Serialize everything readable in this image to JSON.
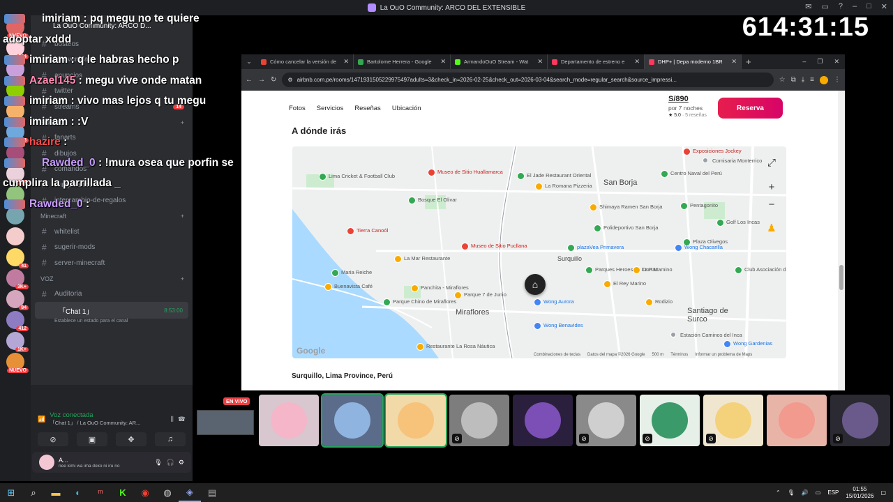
{
  "window": {
    "title": "La OuO Community: ARCO DEL EXTENSIBLE"
  },
  "timer": "614:31:15",
  "chat": [
    {
      "user": "imiriam",
      "text": " : pq megu no te quiere adoptar xddd",
      "color": "white",
      "wrap": true
    },
    {
      "user": "imiriam",
      "text": " : q le habras hecho p",
      "color": "white"
    },
    {
      "user": "Azael145",
      "text": " : megu vive onde matan",
      "color": "pink"
    },
    {
      "user": "imiriam",
      "text": " : vivo mas lejos q tu megu",
      "color": "white"
    },
    {
      "user": "imiriam",
      "text": " : :V",
      "color": "white"
    },
    {
      "user": "hazire",
      "text": " :",
      "color": "red"
    },
    {
      "user": "Rawded_0",
      "text": " : !mura osea que porfin se cumplira la parrillada _",
      "color": "purple",
      "wrap": true
    },
    {
      "user": "Rawded_0",
      "text": " :",
      "color": "purple"
    }
  ],
  "sidebar": {
    "server_name": "La OuO Community: ARCO D...",
    "new_badge": "NUEVO",
    "channels_top": [
      "bosteos",
      "bienvenidas",
      "anuncios",
      "twitter",
      "streams"
    ],
    "streams_badge": "14",
    "category_social": "SOCIAL",
    "channels_social": [
      "fanarts",
      "dibujos",
      "comandos",
      "cumpleaños",
      "intercambio-de-regalos"
    ],
    "category_minecraft": "Minecraft",
    "channels_minecraft": [
      "whitelist",
      "sugerir-mods",
      "server-minecraft"
    ],
    "category_voice": "VOZ",
    "channels_voice": [
      "Auditoria"
    ],
    "voice_channel": {
      "name": "「Chat 1」",
      "time": "8:53:00",
      "status": "Establece un estado para el canal"
    }
  },
  "guild_badges": [
    "NUEVO",
    "544",
    "",
    "",
    "",
    "3",
    "",
    "554",
    "",
    "",
    "",
    "41",
    "3K+",
    "84",
    "412",
    "1K+",
    "NUEVO"
  ],
  "voice_panel": {
    "status": "Voz conectada",
    "channel": "「Chat 1」 / La OuO Community: AR...",
    "user": "A...",
    "user_status": "nee kimi wa ima doko ni iru no"
  },
  "browser": {
    "tabs": [
      {
        "title": "Cómo cancelar la versión de",
        "color": "#ea4335"
      },
      {
        "title": "Bartolome Herrera - Google",
        "color": "#34a853"
      },
      {
        "title": "ArmandoOuO Stream - Wat",
        "color": "#53fc18"
      },
      {
        "title": "Departamento de estreno e",
        "color": "#ff385c"
      },
      {
        "title": "DHP+ | Depa moderno 1BR",
        "color": "#ff385c",
        "active": true
      }
    ],
    "url": "airbnb.com.pe/rooms/1471931505229975497adults=3&check_in=2026-02-25&check_out=2026-03-04&search_mode=regular_search&source_impressi..."
  },
  "listing": {
    "nav": [
      "Fotos",
      "Servicios",
      "Reseñas",
      "Ubicación"
    ],
    "price": "S/890",
    "price_period": "por 7 noches",
    "rating": "★ 5.0",
    "reviews": "· 5 reseñas",
    "reserve_label": "Reserva",
    "section_title": "A dónde irás",
    "location": "Surquillo, Lima Province, Perú"
  },
  "map": {
    "districts": [
      "San Borja",
      "Surquillo",
      "Miraflores",
      "Santiago de Surco"
    ],
    "places": [
      "Exposiciones Jockey",
      "Comisaria Monterrico",
      "Centro Naval del Perú",
      "Museo de Sitio Huallamarca",
      "Lima Cricket & Football Club",
      "El Jade Restaurant Oriental",
      "La Romana Pizzeria",
      "Bosque El Olivar",
      "Shimaya Ramen San Borja",
      "Pentagonito",
      "Golf Los Incas",
      "Tierra Canoól",
      "Polideportivo San Borja",
      "Plaza Olivegos",
      "Museo de Sitio Pucllana",
      "plazaVea Primavera",
      "Wong Chacarilla",
      "Maria Reiche",
      "Parques Heroes de La Paz",
      "Don Mamino",
      "Club Asociación de la Policía",
      "Buenavista Café",
      "Panchita - Miraflores",
      "El Rey Marino",
      "Parque Chino de Miraflores",
      "Parque 7 de Junio",
      "Wong Aurora",
      "Rodizio",
      "Wong Benavides",
      "Restaurante La Rosa Náutica",
      "Estación Caminos del Inca",
      "Wong Gardenias",
      "La Mar Restaurante"
    ],
    "footer": [
      "Combinaciones de teclas",
      "Datos del mapa ©2026 Google",
      "500 m",
      "Términos",
      "Informar un problema de Maps"
    ],
    "logo": "Google"
  },
  "stream_strip": {
    "live_label": "EN VIVO"
  },
  "taskbar": {
    "lang": "ESP",
    "time": "01:55",
    "date": "15/01/2026"
  }
}
